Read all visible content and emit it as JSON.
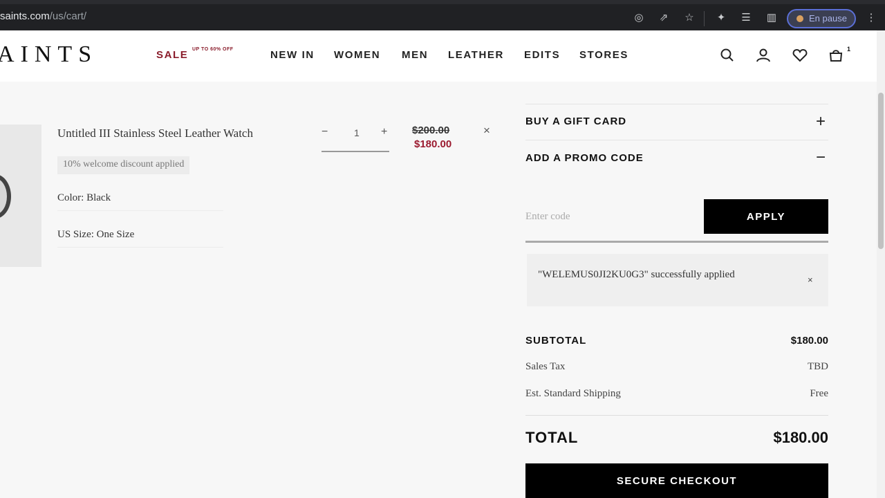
{
  "browser": {
    "url_host": "saints.com",
    "url_path": "/us/cart/",
    "profile_label": "En pause"
  },
  "header": {
    "logo": "AINTS",
    "nav": [
      {
        "label": "SALE",
        "tag": "UP TO 60% OFF"
      },
      {
        "label": "NEW IN"
      },
      {
        "label": "WOMEN"
      },
      {
        "label": "MEN"
      },
      {
        "label": "LEATHER"
      },
      {
        "label": "EDITS"
      },
      {
        "label": "STORES"
      }
    ],
    "cart_count": "1",
    "icons": [
      "search-icon",
      "account-icon",
      "wishlist-icon",
      "bag-icon"
    ]
  },
  "cart": {
    "item": {
      "title": "Untitled III Stainless Steel Leather Watch",
      "discount_note": "10% welcome discount applied",
      "color": "Color: Black",
      "size": "US Size: One Size",
      "qty": "1",
      "qty_minus": "−",
      "qty_plus": "+",
      "price_original": "$200.00",
      "price_sale": "$180.00",
      "remove": "×"
    }
  },
  "summary": {
    "gift_card": "BUY A GIFT CARD",
    "promo_title": "ADD A PROMO CODE",
    "gift_toggle": "+",
    "promo_toggle": "−",
    "promo_placeholder": "Enter code",
    "apply_label": "APPLY",
    "applied_message": "\"WELEMUS0JI2KU0G3\" successfully applied",
    "applied_close": "×",
    "subtotal_label": "SUBTOTAL",
    "subtotal_value": "$180.00",
    "tax_label": "Sales Tax",
    "tax_value": "TBD",
    "shipping_label": "Est. Standard Shipping",
    "shipping_value": "Free",
    "total_label": "TOTAL",
    "total_value": "$180.00",
    "checkout_label": "SECURE CHECKOUT"
  },
  "colors": {
    "sale": "#8a1c2b",
    "discount_price": "#9b1b30",
    "button": "#000000"
  }
}
